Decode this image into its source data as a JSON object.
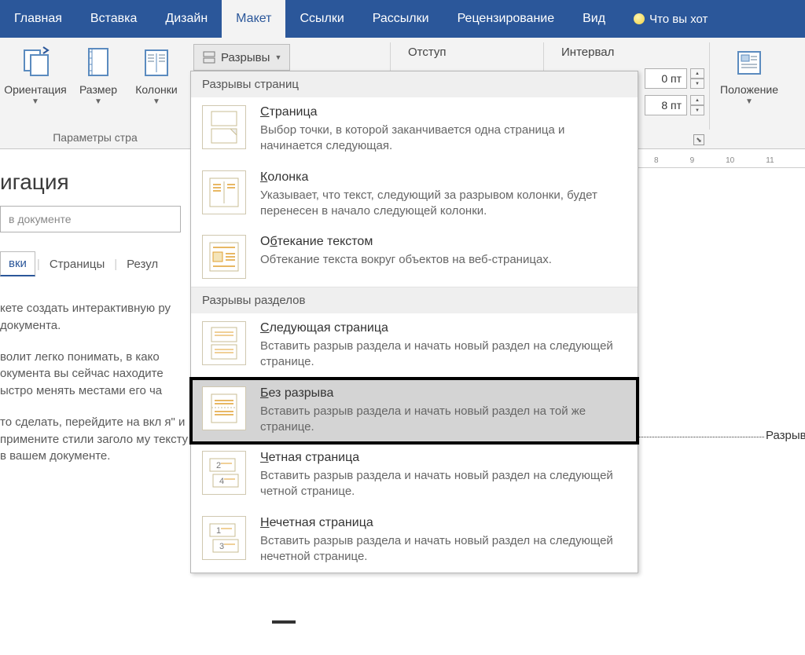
{
  "tabs": {
    "home": "Главная",
    "insert": "Вставка",
    "design": "Дизайн",
    "layout": "Макет",
    "references": "Ссылки",
    "mailings": "Рассылки",
    "review": "Рецензирование",
    "view": "Вид",
    "tellme": "Что вы хот"
  },
  "ribbon": {
    "orientation": "Ориентация",
    "size": "Размер",
    "columns": "Колонки",
    "breaks": "Разрывы",
    "page_setup_label": "Параметры стра",
    "indent_label": "Отступ",
    "spacing_label": "Интервал",
    "spin1": "0 пт",
    "spin2": "8 пт",
    "position": "Положение"
  },
  "menu": {
    "section1": "Разрывы страниц",
    "page_t": "Страница",
    "page_d": "Выбор точки, в которой заканчивается одна страница и начинается следующая.",
    "col_t": "Колонка",
    "col_d": "Указывает, что текст, следующий за разрывом колонки, будет перенесен в начало следующей колонки.",
    "wrap_t": "Обтекание текстом",
    "wrap_d": "Обтекание текста вокруг объектов на веб-страницах.",
    "section2": "Разрывы разделов",
    "next_t": "Следующая страница",
    "next_d": "Вставить разрыв раздела и начать новый раздел на следующей странице.",
    "cont_t": "Без разрыва",
    "cont_d": "Вставить разрыв раздела и начать новый раздел на той же странице.",
    "even_t": "Четная страница",
    "even_d": "Вставить разрыв раздела и начать новый раздел на следующей четной странице.",
    "odd_t": "Нечетная страница",
    "odd_d": "Вставить разрыв раздела и начать новый раздел на следующей нечетной странице."
  },
  "nav": {
    "title": "игация",
    "search_ph": "в документе",
    "tab_headings": "вки",
    "tab_pages": "Страницы",
    "tab_results": "Резул",
    "p1": "кете создать интерактивную ру документа.",
    "p2": "волит легко понимать, в како окумента вы сейчас находите ыстро менять местами его ча",
    "p3": "то сделать, перейдите на вкл я\" и примените стили заголо му тексту в вашем документе."
  },
  "ruler": {
    "t8": "8",
    "t9": "9",
    "t10": "10",
    "t11": "11"
  },
  "annot": "Разрыв"
}
